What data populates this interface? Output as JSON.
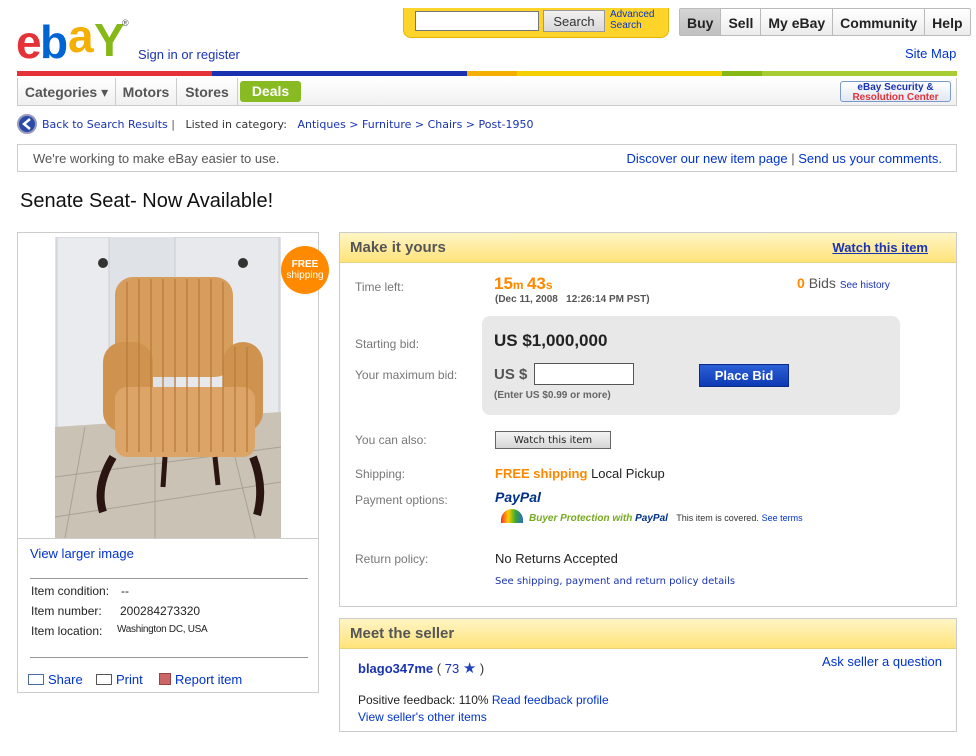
{
  "header": {
    "signin": "Sign in or register",
    "search_placeholder": "",
    "search_button": "Search",
    "advanced_search": "Advanced Search",
    "tabs": [
      "Buy",
      "Sell",
      "My eBay",
      "Community",
      "Help"
    ],
    "site_map": "Site Map"
  },
  "categories": {
    "items": [
      "Categories ▾",
      "Motors",
      "Stores"
    ],
    "deals": "Deals",
    "security_line1": "eBay Security &",
    "security_line2": "Resolution Center"
  },
  "breadcrumb": {
    "back": "Back to Search Results",
    "listed": "Listed in category:",
    "path": "Antiques > Furniture > Chairs > Post-1950"
  },
  "infobar": {
    "left": "We're working to make eBay easier to use.",
    "discover": "Discover our new item page",
    "send": "Send us your comments."
  },
  "item": {
    "title": "Senate Seat- Now Available!",
    "free_shipping_line1": "FREE",
    "free_shipping_line2": "shipping",
    "view_larger": "View larger image",
    "condition_label": "Item condition:",
    "condition_value": "--",
    "number_label": "Item number:",
    "number_value": "200284273320",
    "location_label": "Item location:",
    "location_value": "Washington DC, USA",
    "share": "Share",
    "print": "Print",
    "report": "Report item"
  },
  "bid": {
    "heading": "Make it yours",
    "watch_link": "Watch this item",
    "time_left_label": "Time left:",
    "time_min": "15",
    "time_min_unit": "m",
    "time_sec": "43",
    "time_sec_unit": "s",
    "end_date": "(Dec 11, 2008   12:26:14 PM PST)",
    "bids_count": "0",
    "bids_label": "Bids",
    "see_history": "See history",
    "starting_bid_label": "Starting bid:",
    "starting_bid_value": "US $1,000,000",
    "max_bid_label": "Your maximum bid:",
    "max_bid_currency": "US $",
    "max_bid_value": "",
    "enter_min": "(Enter US $0.99 or more)",
    "place_bid": "Place Bid",
    "can_also_label": "You can also:",
    "watch_button": "Watch this item",
    "shipping_label": "Shipping:",
    "shipping_free": "FREE shipping",
    "shipping_method": "Local Pickup",
    "payment_label": "Payment options:",
    "paypal": "PayPal",
    "buyer_protection": "Buyer Protection with",
    "buyer_protection_paypal": "PayPal",
    "covered": "This item is covered.",
    "see_terms": "See terms",
    "return_label": "Return policy:",
    "return_value": "No Returns Accepted",
    "see_shipping": "See shipping, payment and return policy details"
  },
  "seller": {
    "heading": "Meet the seller",
    "name": "blago347me",
    "score_open": " ( ",
    "score": "73",
    "score_close": " )",
    "ask": "Ask seller a question",
    "positive_label": "Positive feedback:",
    "positive_value": "110%",
    "read_profile": "Read feedback profile",
    "other_items": "View seller's other items"
  },
  "colors": {
    "ebay_red": "#e53238",
    "ebay_blue": "#0064d2",
    "ebay_yellow": "#f5af02",
    "ebay_green": "#86b817",
    "link": "#1a33b2",
    "orange": "#ff8800"
  }
}
